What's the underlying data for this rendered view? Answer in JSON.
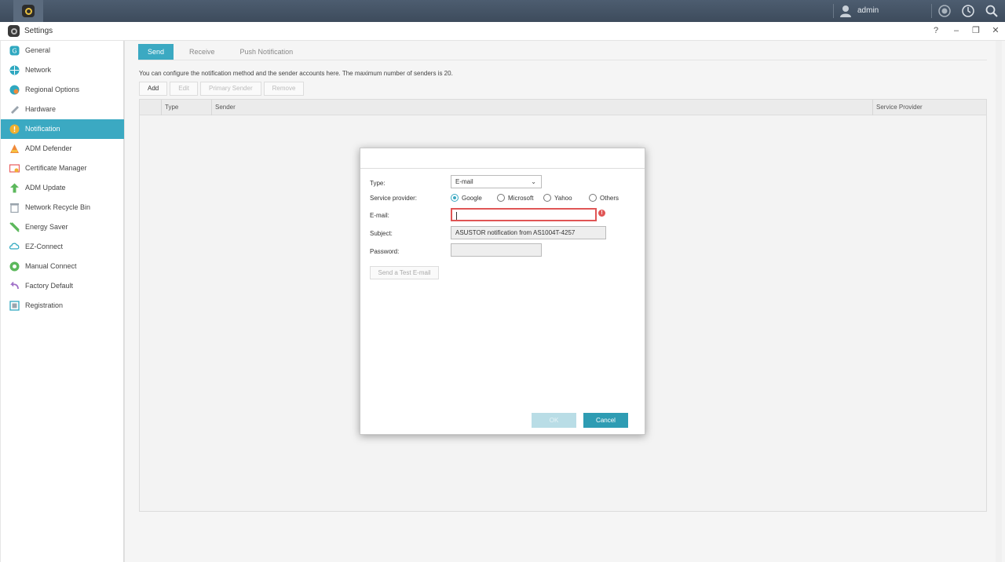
{
  "topbar": {
    "user_name": "admin"
  },
  "window": {
    "title": "Settings"
  },
  "sidebar": {
    "items": [
      {
        "label": "General",
        "icon": "general-icon",
        "color": "#2fa8c0"
      },
      {
        "label": "Network",
        "icon": "network-icon",
        "color": "#2fa8c0"
      },
      {
        "label": "Regional Options",
        "icon": "regional-icon",
        "color": "#2fa8c0"
      },
      {
        "label": "Hardware",
        "icon": "hardware-icon",
        "color": "#9aa4ad"
      },
      {
        "label": "Notification",
        "icon": "notification-icon",
        "color": "#f0b030"
      },
      {
        "label": "ADM Defender",
        "icon": "defender-icon",
        "color": "#f08a3a"
      },
      {
        "label": "Certificate Manager",
        "icon": "certificate-icon",
        "color": "#e85a5a"
      },
      {
        "label": "ADM Update",
        "icon": "update-icon",
        "color": "#5cb85c"
      },
      {
        "label": "Network Recycle Bin",
        "icon": "recycle-bin-icon",
        "color": "#9aa4ad"
      },
      {
        "label": "Energy Saver",
        "icon": "energy-icon",
        "color": "#5cb85c"
      },
      {
        "label": "EZ-Connect",
        "icon": "ez-connect-icon",
        "color": "#2fa8c0"
      },
      {
        "label": "Manual Connect",
        "icon": "manual-connect-icon",
        "color": "#5cb85c"
      },
      {
        "label": "Factory Default",
        "icon": "factory-default-icon",
        "color": "#a070c8"
      },
      {
        "label": "Registration",
        "icon": "registration-icon",
        "color": "#2fa8c0"
      }
    ],
    "active_index": 4
  },
  "tabs": [
    {
      "label": "Send"
    },
    {
      "label": "Receive"
    },
    {
      "label": "Push Notification"
    }
  ],
  "description": "You can configure the notification method and the sender accounts here. The maximum number of senders is 20.",
  "toolbar": {
    "add": "Add",
    "edit": "Edit",
    "primary": "Primary Sender",
    "remove": "Remove"
  },
  "grid": {
    "columns": [
      "Type",
      "Sender",
      "Service Provider"
    ]
  },
  "dialog": {
    "type_label": "Type:",
    "type_value": "E-mail",
    "provider_label": "Service provider:",
    "providers": [
      "Google",
      "Microsoft",
      "Yahoo",
      "Others"
    ],
    "selected_provider": "Google",
    "email_label": "E-mail:",
    "email_value": "",
    "subject_label": "Subject:",
    "subject_value": "ASUSTOR notification from AS1004T-4257",
    "password_label": "Password:",
    "password_value": "",
    "test_button": "Send a Test E-mail",
    "ok": "OK",
    "cancel": "Cancel"
  },
  "colors": {
    "accent": "#3ba9c2",
    "error": "#e05555"
  }
}
